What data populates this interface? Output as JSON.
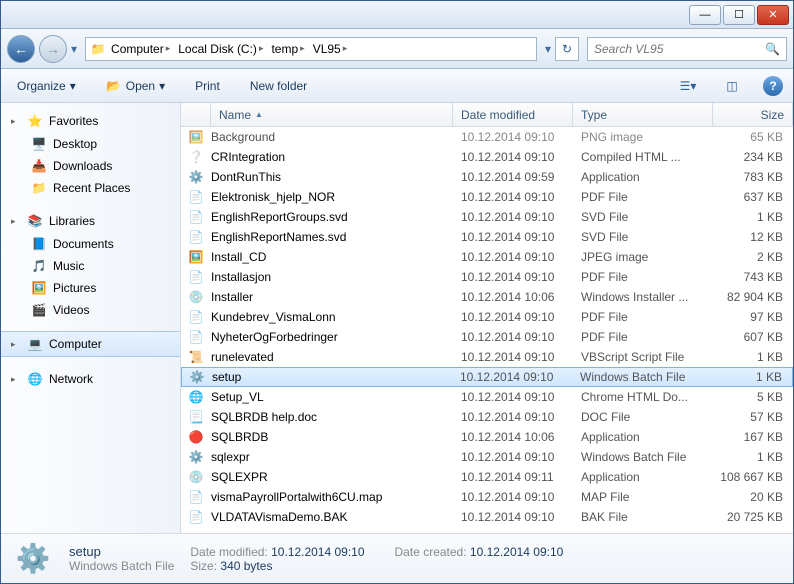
{
  "window_controls": {
    "min": "—",
    "max": "☐",
    "close": "✕"
  },
  "nav": {
    "back": "←",
    "fwd": "→"
  },
  "breadcrumb": [
    "Computer",
    "Local Disk (C:)",
    "temp",
    "VL95"
  ],
  "search": {
    "placeholder": "Search VL95"
  },
  "toolbar": {
    "organize": "Organize",
    "open": "Open",
    "print": "Print",
    "new_folder": "New folder"
  },
  "sidebar": {
    "favorites": {
      "label": "Favorites",
      "items": [
        "Desktop",
        "Downloads",
        "Recent Places"
      ]
    },
    "libraries": {
      "label": "Libraries",
      "items": [
        "Documents",
        "Music",
        "Pictures",
        "Videos"
      ]
    },
    "computer": {
      "label": "Computer"
    },
    "network": {
      "label": "Network"
    }
  },
  "columns": {
    "name": "Name",
    "date": "Date modified",
    "type": "Type",
    "size": "Size"
  },
  "files": [
    {
      "icon": "🖼️",
      "name": "Background",
      "date": "10.12.2014 09:10",
      "type": "PNG image",
      "size": "65 KB",
      "cut": true
    },
    {
      "icon": "❔",
      "name": "CRIntegration",
      "date": "10.12.2014 09:10",
      "type": "Compiled HTML ...",
      "size": "234 KB"
    },
    {
      "icon": "⚙️",
      "name": "DontRunThis",
      "date": "10.12.2014 09:59",
      "type": "Application",
      "size": "783 KB"
    },
    {
      "icon": "📄",
      "name": "Elektronisk_hjelp_NOR",
      "date": "10.12.2014 09:10",
      "type": "PDF File",
      "size": "637 KB"
    },
    {
      "icon": "📄",
      "name": "EnglishReportGroups.svd",
      "date": "10.12.2014 09:10",
      "type": "SVD File",
      "size": "1 KB"
    },
    {
      "icon": "📄",
      "name": "EnglishReportNames.svd",
      "date": "10.12.2014 09:10",
      "type": "SVD File",
      "size": "12 KB"
    },
    {
      "icon": "🖼️",
      "name": "Install_CD",
      "date": "10.12.2014 09:10",
      "type": "JPEG image",
      "size": "2 KB"
    },
    {
      "icon": "📄",
      "name": "Installasjon",
      "date": "10.12.2014 09:10",
      "type": "PDF File",
      "size": "743 KB"
    },
    {
      "icon": "💿",
      "name": "Installer",
      "date": "10.12.2014 10:06",
      "type": "Windows Installer ...",
      "size": "82 904 KB"
    },
    {
      "icon": "📄",
      "name": "Kundebrev_VismaLonn",
      "date": "10.12.2014 09:10",
      "type": "PDF File",
      "size": "97 KB"
    },
    {
      "icon": "📄",
      "name": "NyheterOgForbedringer",
      "date": "10.12.2014 09:10",
      "type": "PDF File",
      "size": "607 KB"
    },
    {
      "icon": "📜",
      "name": "runelevated",
      "date": "10.12.2014 09:10",
      "type": "VBScript Script File",
      "size": "1 KB"
    },
    {
      "icon": "⚙️",
      "name": "setup",
      "date": "10.12.2014 09:10",
      "type": "Windows Batch File",
      "size": "1 KB",
      "selected": true
    },
    {
      "icon": "🌐",
      "name": "Setup_VL",
      "date": "10.12.2014 09:10",
      "type": "Chrome HTML Do...",
      "size": "5 KB"
    },
    {
      "icon": "📃",
      "name": "SQLBRDB help.doc",
      "date": "10.12.2014 09:10",
      "type": "DOC File",
      "size": "57 KB"
    },
    {
      "icon": "🔴",
      "name": "SQLBRDB",
      "date": "10.12.2014 10:06",
      "type": "Application",
      "size": "167 KB"
    },
    {
      "icon": "⚙️",
      "name": "sqlexpr",
      "date": "10.12.2014 09:10",
      "type": "Windows Batch File",
      "size": "1 KB"
    },
    {
      "icon": "💿",
      "name": "SQLEXPR",
      "date": "10.12.2014 09:11",
      "type": "Application",
      "size": "108 667 KB"
    },
    {
      "icon": "📄",
      "name": "vismaPayrollPortalwith6CU.map",
      "date": "10.12.2014 09:10",
      "type": "MAP File",
      "size": "20 KB"
    },
    {
      "icon": "📄",
      "name": "VLDATAVismaDemo.BAK",
      "date": "10.12.2014 09:10",
      "type": "BAK File",
      "size": "20 725 KB"
    }
  ],
  "details": {
    "name": "setup",
    "type": "Windows Batch File",
    "date_modified_label": "Date modified:",
    "date_modified": "10.12.2014 09:10",
    "size_label": "Size:",
    "size": "340 bytes",
    "date_created_label": "Date created:",
    "date_created": "10.12.2014 09:10"
  }
}
